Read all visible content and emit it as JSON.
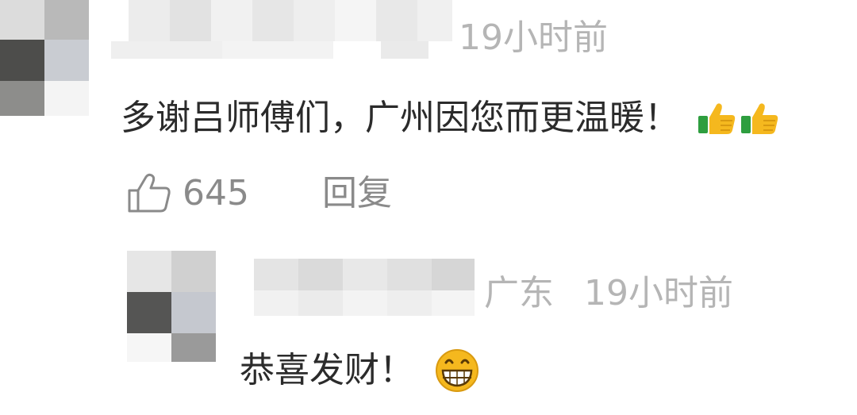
{
  "comments": [
    {
      "time": "19小时前",
      "text": "多谢吕师傅们，广州因您而更温暖！",
      "emoji": [
        "thumbs-up",
        "thumbs-up"
      ],
      "likes": "645",
      "reply_label": "回复"
    }
  ],
  "reply": {
    "location": "广东",
    "time": "19小时前",
    "text": "恭喜发财！",
    "emoji": "grinning-face"
  },
  "colors": {
    "text": "#2b2b2b",
    "meta": "#b5b5b5",
    "action": "#8a8a8a",
    "emoji_yellow": "#f5b81e",
    "emoji_green": "#2e9e3f"
  }
}
